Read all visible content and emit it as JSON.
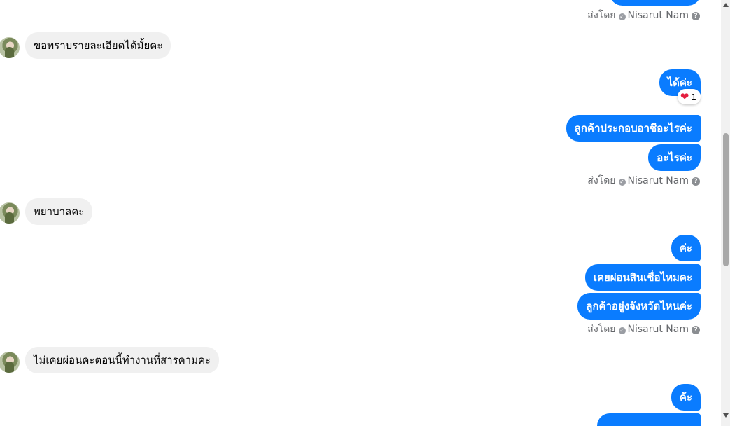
{
  "sent_by": {
    "prefix": "ส่งโดย",
    "name": "Nisarut Nam",
    "help": "?"
  },
  "messages": {
    "in_1": "ขอทราบรายละเอียดได้มั้ยคะ",
    "out_1": "ได้ค่ะ",
    "out_2": "ลูกค้าประกอบอาชีอะไรค่ะ",
    "out_3": "อะไรค่ะ",
    "in_2": "พยาบาลคะ",
    "out_4": "ค่ะ",
    "out_5": "เคยผ่อนสินเชื่อไหมคะ",
    "out_6": "ลูกค้าอยู่งจังหวัดไหนค่ะ",
    "in_3": "ไม่เคยผ่อนคะตอนนี้ทำงานที่สารคามคะ",
    "out_7": "ค้ะ"
  },
  "reaction": {
    "emoji": "❤",
    "count": "1"
  },
  "colors": {
    "outgoing": "#0a7cff",
    "incoming": "#f0f0f0",
    "meta_text": "#65676b"
  }
}
